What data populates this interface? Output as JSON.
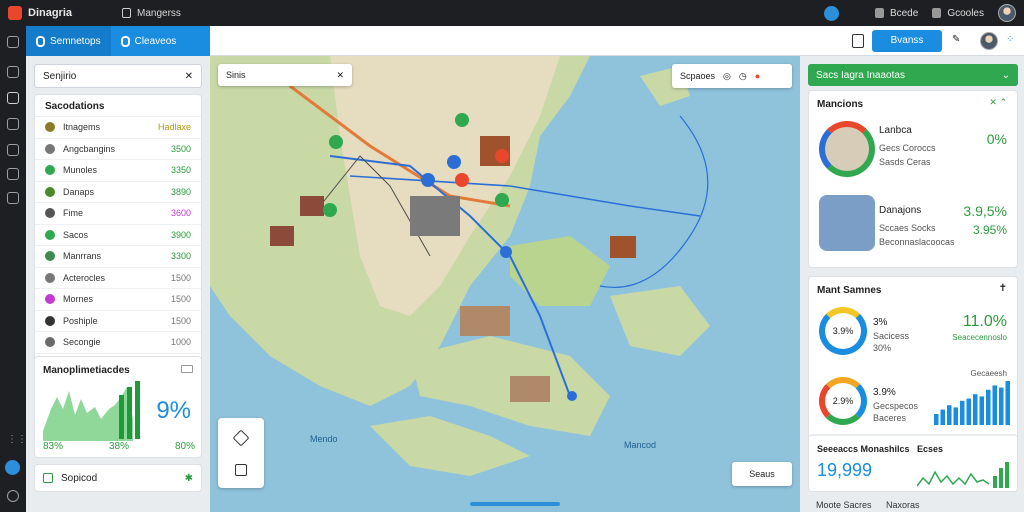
{
  "app": {
    "title": "Dinagria"
  },
  "topbar": {
    "tab_label": "Mangerss",
    "user_items": [
      "Bcede",
      "Gcooles"
    ]
  },
  "tabs": [
    {
      "label": "Semnetops",
      "active": true
    },
    {
      "label": "Cleaveos",
      "active": false
    }
  ],
  "toolbar": {
    "button_label": "Bvanss"
  },
  "left_panel": {
    "search_value": "Senjirio",
    "list_title": "Sacodations",
    "items": [
      {
        "name": "Itnagems",
        "value": "Hadlaxe",
        "color": "#8a7a2a",
        "value_color": "#b49b12"
      },
      {
        "name": "Angcbangins",
        "value": "3500",
        "color": "#777777",
        "value_color": "#2a9a3c"
      },
      {
        "name": "Munoles",
        "value": "3350",
        "color": "#2fa84f",
        "value_color": "#2a9a3c"
      },
      {
        "name": "Danaps",
        "value": "3890",
        "color": "#4b8a2a",
        "value_color": "#2a9a3c"
      },
      {
        "name": "Fime",
        "value": "3600",
        "color": "#555555",
        "value_color": "#c23bd1"
      },
      {
        "name": "Sacos",
        "value": "3900",
        "color": "#2fa84f",
        "value_color": "#2a9a3c"
      },
      {
        "name": "Manrrans",
        "value": "3300",
        "color": "#3f8a4f",
        "value_color": "#2a9a3c"
      },
      {
        "name": "Acterocles",
        "value": "1500",
        "color": "#777777",
        "value_color": "#777777"
      },
      {
        "name": "Mornes",
        "value": "1500",
        "color": "#c23bd1",
        "value_color": "#777777"
      },
      {
        "name": "Poshiple",
        "value": "1500",
        "color": "#333333",
        "value_color": "#777777"
      },
      {
        "name": "Secongie",
        "value": "1000",
        "color": "#6a6a6a",
        "value_color": "#777777"
      }
    ],
    "chart_card": {
      "title": "Manoplimetiacdes",
      "big_value": "9%",
      "foot_values": [
        "83%",
        "38%",
        "80%"
      ]
    },
    "bottom_card_label": "Sopicod"
  },
  "map": {
    "search_value": "Sinis",
    "tools_label": "Scpaoes",
    "button_label": "Seaus",
    "labels": [
      "Mendo",
      "Mancod"
    ]
  },
  "right_panel": {
    "header_label": "Sacs Iagra Inaaotas",
    "card1": {
      "title": "Mancions",
      "rows": [
        {
          "title": "Lanbca",
          "sub": "Gecs Coroccs",
          "sub2": "Sasds Ceras",
          "value": "0%",
          "value_color": "#2a9a3c"
        },
        {
          "title": "Danajons",
          "sub": "Sccaes Socks",
          "sub2": "Beconnaslacoocas",
          "value": "3.9,5%",
          "value2": "3.95%",
          "value_color": "#2a9a3c"
        }
      ]
    },
    "card2": {
      "title": "Mant Samnes",
      "donut1": {
        "center": "3.9%",
        "label": "3%",
        "sub": "Sacicess",
        "sub2": "30%",
        "value": "11.0%",
        "sub_right": "Seacecennoslo"
      },
      "donut2": {
        "center": "2.9%",
        "label": "3.9%",
        "sub": "Gecspecos",
        "sub2": "Baceres",
        "bar_label": "Gecaeesh",
        "bars": [
          0.25,
          0.35,
          0.45,
          0.4,
          0.55,
          0.6,
          0.7,
          0.65,
          0.8,
          0.9,
          0.85,
          1.0
        ]
      }
    },
    "card3": {
      "title": "Seeeaccs Monashilcs",
      "label2": "Ecses",
      "big_value": "19,999"
    },
    "footer": [
      "Moote Sacres",
      "Naxoras"
    ]
  },
  "colors": {
    "accent": "#1a8de0",
    "green": "#2fa84f",
    "topbar": "#1e1f22"
  }
}
